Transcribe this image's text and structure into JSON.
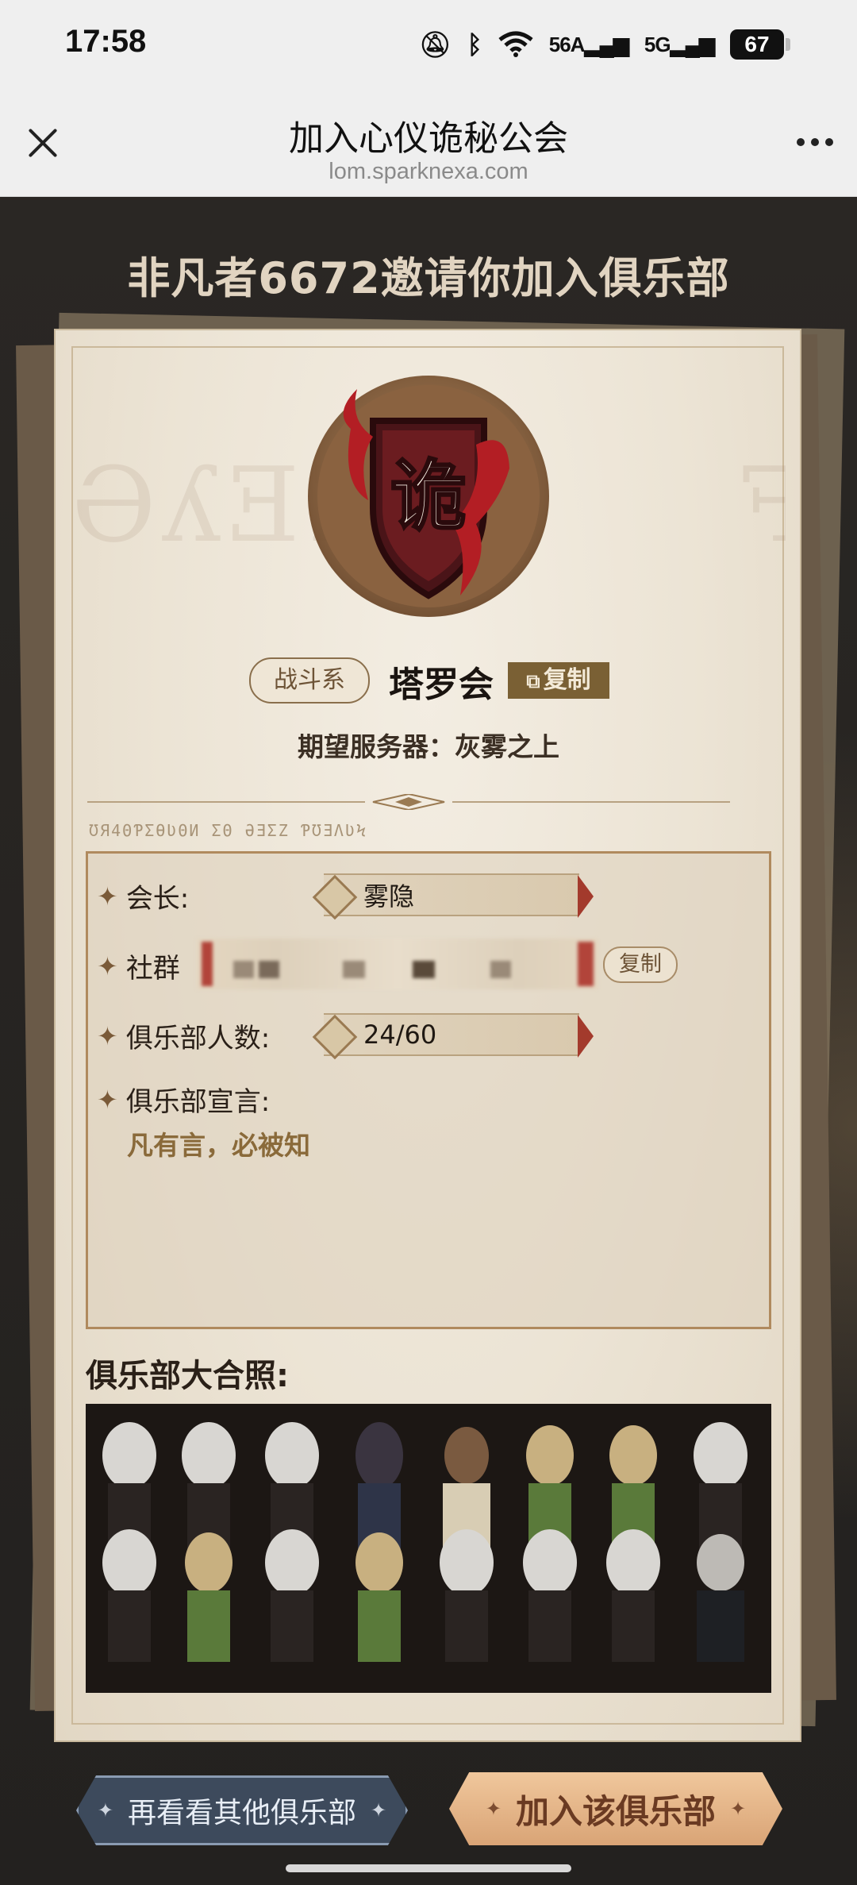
{
  "status_bar": {
    "time": "17:58",
    "signal1": "56A",
    "signal2": "5G",
    "battery": "67"
  },
  "browser": {
    "title": "加入心仪诡秘公会",
    "url": "lom.sparknexa.com"
  },
  "invite_title": "非凡者6672邀请你加入俱乐部",
  "emblem": {
    "char": "诡"
  },
  "club": {
    "type_tag": "战斗系",
    "name": "塔罗会",
    "copy_label": "复制",
    "server_line": "期望服务器：灰雾之上"
  },
  "info": {
    "leader_label": "会长:",
    "leader_value": "雾隐",
    "social_label": "社群",
    "social_copy_label": "复制",
    "members_label": "俱乐部人数:",
    "members_value": "24/60",
    "manifesto_label": "俱乐部宣言:",
    "manifesto_text": "凡有言，必被知"
  },
  "photo_title": "俱乐部大合照:",
  "buttons": {
    "other": "再看看其他俱乐部",
    "join": "加入该俱乐部"
  },
  "colors": {
    "accent_red": "#a33a2c",
    "gold": "#7a6034",
    "join_bg": "#e2b285",
    "other_bg": "#3d4a5c"
  }
}
